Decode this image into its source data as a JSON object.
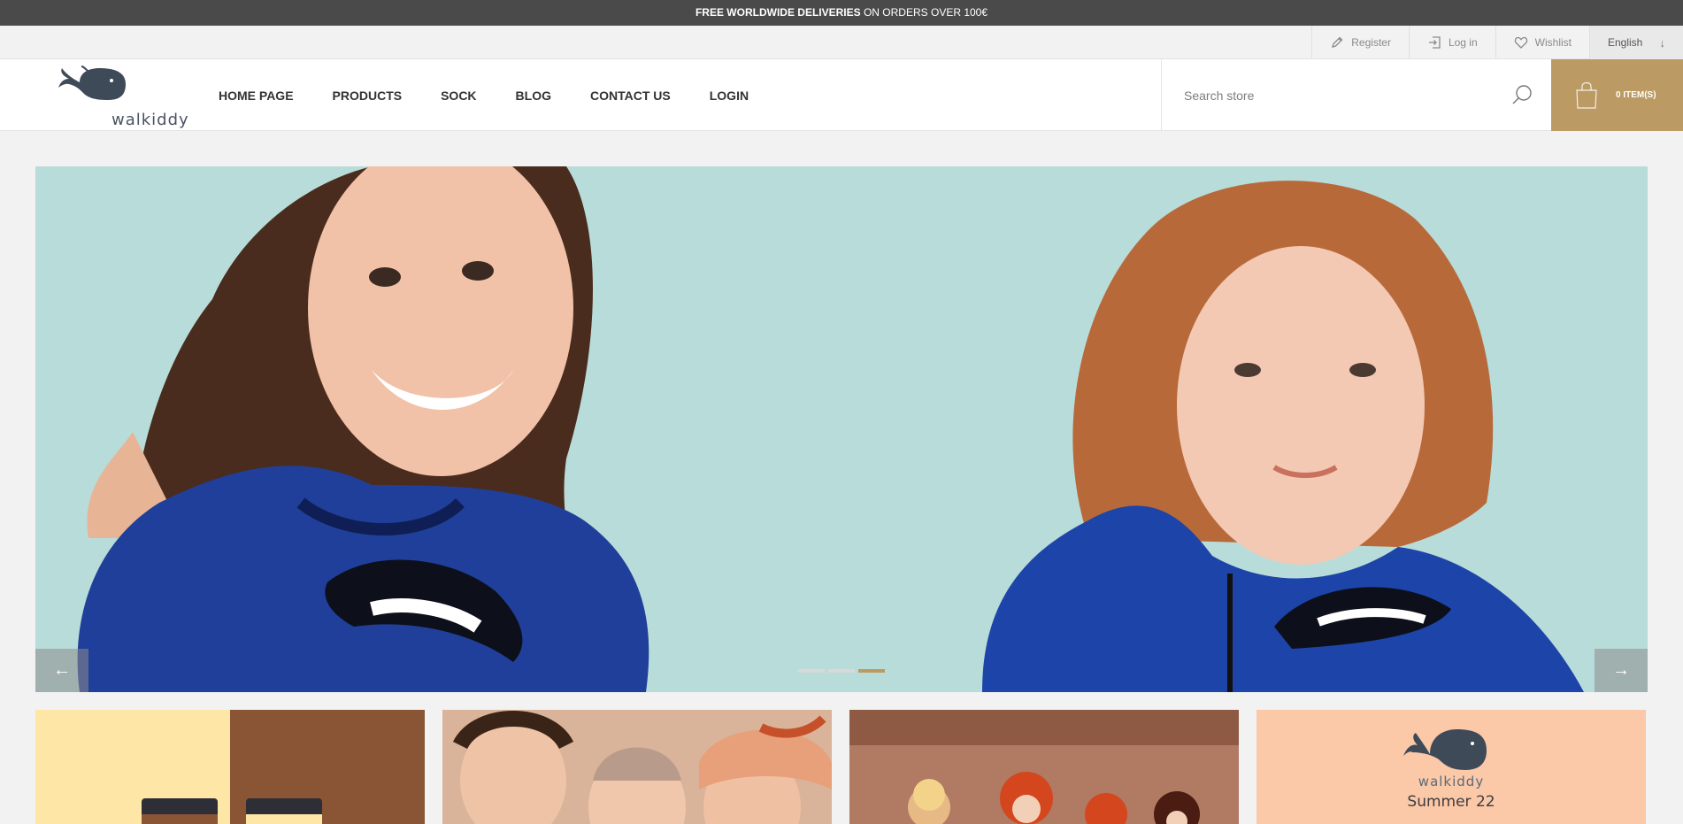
{
  "promo": {
    "bold": "FREE WORLDWIDE DELIVERIES",
    "rest": " ON ORDERS OVER 100€"
  },
  "util": {
    "register": "Register",
    "login": "Log in",
    "wishlist": "Wishlist",
    "language": "English"
  },
  "logo": {
    "text": "walkiddy"
  },
  "nav": {
    "items": [
      "HOME PAGE",
      "PRODUCTS",
      "SOCK",
      "BLOG",
      "CONTACT US",
      "LOGIN"
    ]
  },
  "search": {
    "placeholder": "Search store"
  },
  "cart": {
    "count_label": "0 ITEM(S)"
  },
  "slider": {
    "prev_label": "←",
    "next_label": "→",
    "dots": 3,
    "active_dot": 3
  },
  "tiles": [
    {
      "name": "tile-socks"
    },
    {
      "name": "tile-kids"
    },
    {
      "name": "tile-dolls"
    },
    {
      "name": "tile-summer",
      "brand": "walkiddy",
      "subtitle": "Summer 22"
    }
  ],
  "colors": {
    "accent": "#bb9a64",
    "promo_bg": "#4a4a4a",
    "slider_bg": "#b8dcd9"
  }
}
